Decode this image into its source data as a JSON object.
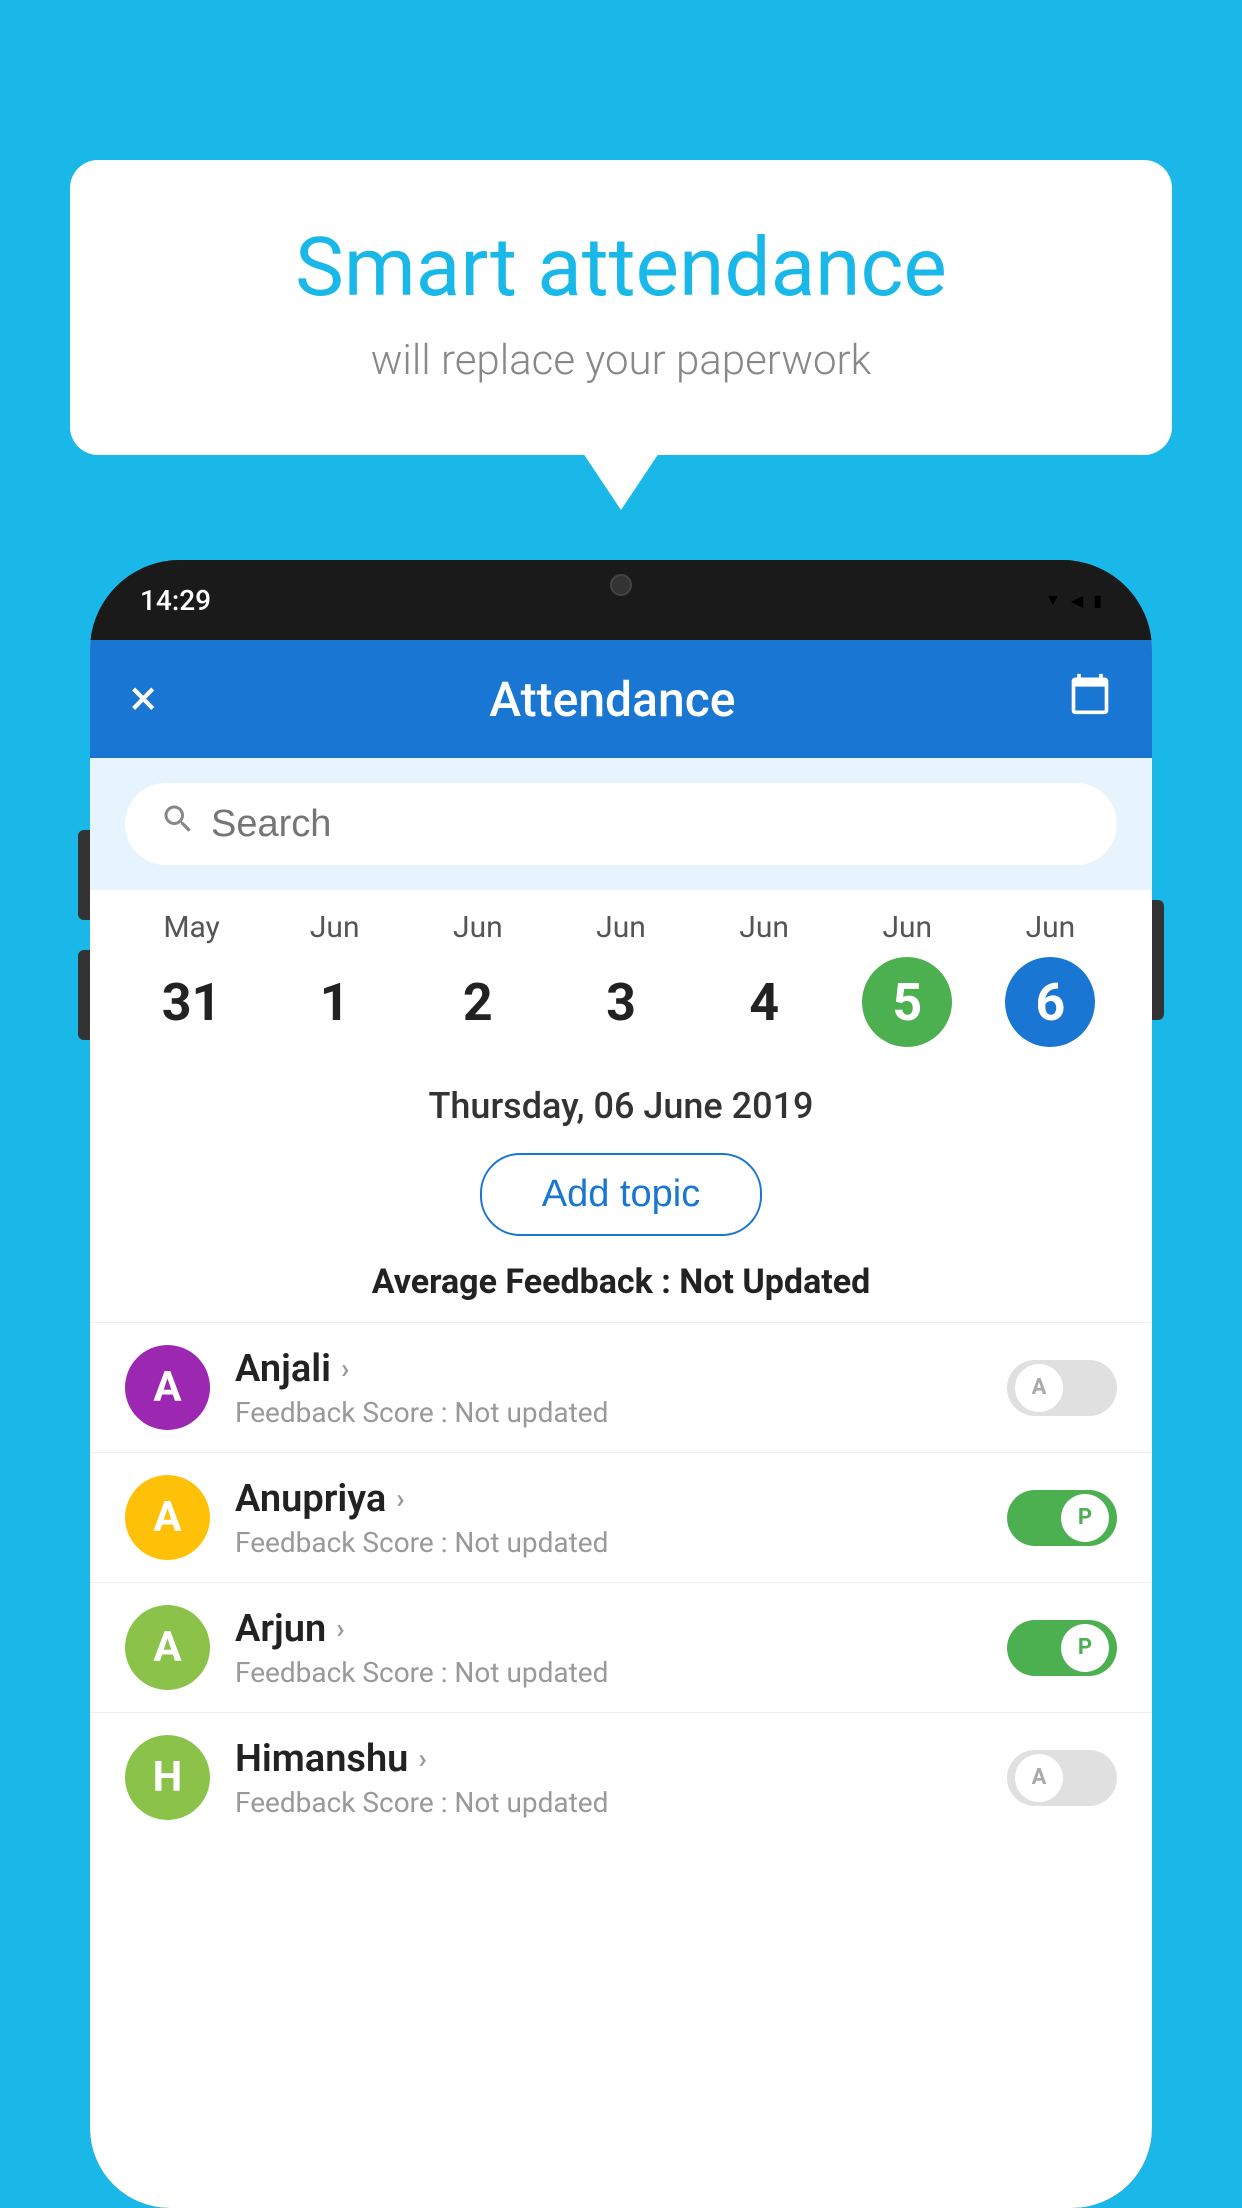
{
  "background": {
    "color": "#1ab8e8"
  },
  "speech_bubble": {
    "title": "Smart attendance",
    "subtitle": "will replace your paperwork"
  },
  "status_bar": {
    "time": "14:29",
    "icons": [
      "wifi",
      "signal",
      "battery"
    ]
  },
  "app_header": {
    "title": "Attendance",
    "close_label": "×",
    "calendar_icon": "📅"
  },
  "search": {
    "placeholder": "Search"
  },
  "calendar": {
    "days": [
      {
        "month": "May",
        "date": "31",
        "highlight": "none"
      },
      {
        "month": "Jun",
        "date": "1",
        "highlight": "none"
      },
      {
        "month": "Jun",
        "date": "2",
        "highlight": "none"
      },
      {
        "month": "Jun",
        "date": "3",
        "highlight": "none"
      },
      {
        "month": "Jun",
        "date": "4",
        "highlight": "none"
      },
      {
        "month": "Jun",
        "date": "5",
        "highlight": "green"
      },
      {
        "month": "Jun",
        "date": "6",
        "highlight": "blue"
      }
    ],
    "selected_date": "Thursday, 06 June 2019"
  },
  "add_topic": {
    "label": "Add topic"
  },
  "avg_feedback": {
    "label": "Average Feedback :",
    "value": "Not Updated"
  },
  "students": [
    {
      "name": "Anjali",
      "avatar_letter": "A",
      "avatar_color": "#9c27b0",
      "feedback": "Feedback Score : Not updated",
      "toggle": "off",
      "toggle_label": "A"
    },
    {
      "name": "Anupriya",
      "avatar_letter": "A",
      "avatar_color": "#ffc107",
      "feedback": "Feedback Score : Not updated",
      "toggle": "on",
      "toggle_label": "P"
    },
    {
      "name": "Arjun",
      "avatar_letter": "A",
      "avatar_color": "#8bc34a",
      "feedback": "Feedback Score : Not updated",
      "toggle": "on",
      "toggle_label": "P"
    },
    {
      "name": "Himanshu",
      "avatar_letter": "H",
      "avatar_color": "#8bc34a",
      "feedback": "Feedback Score : Not updated",
      "toggle": "off",
      "toggle_label": "A"
    }
  ]
}
